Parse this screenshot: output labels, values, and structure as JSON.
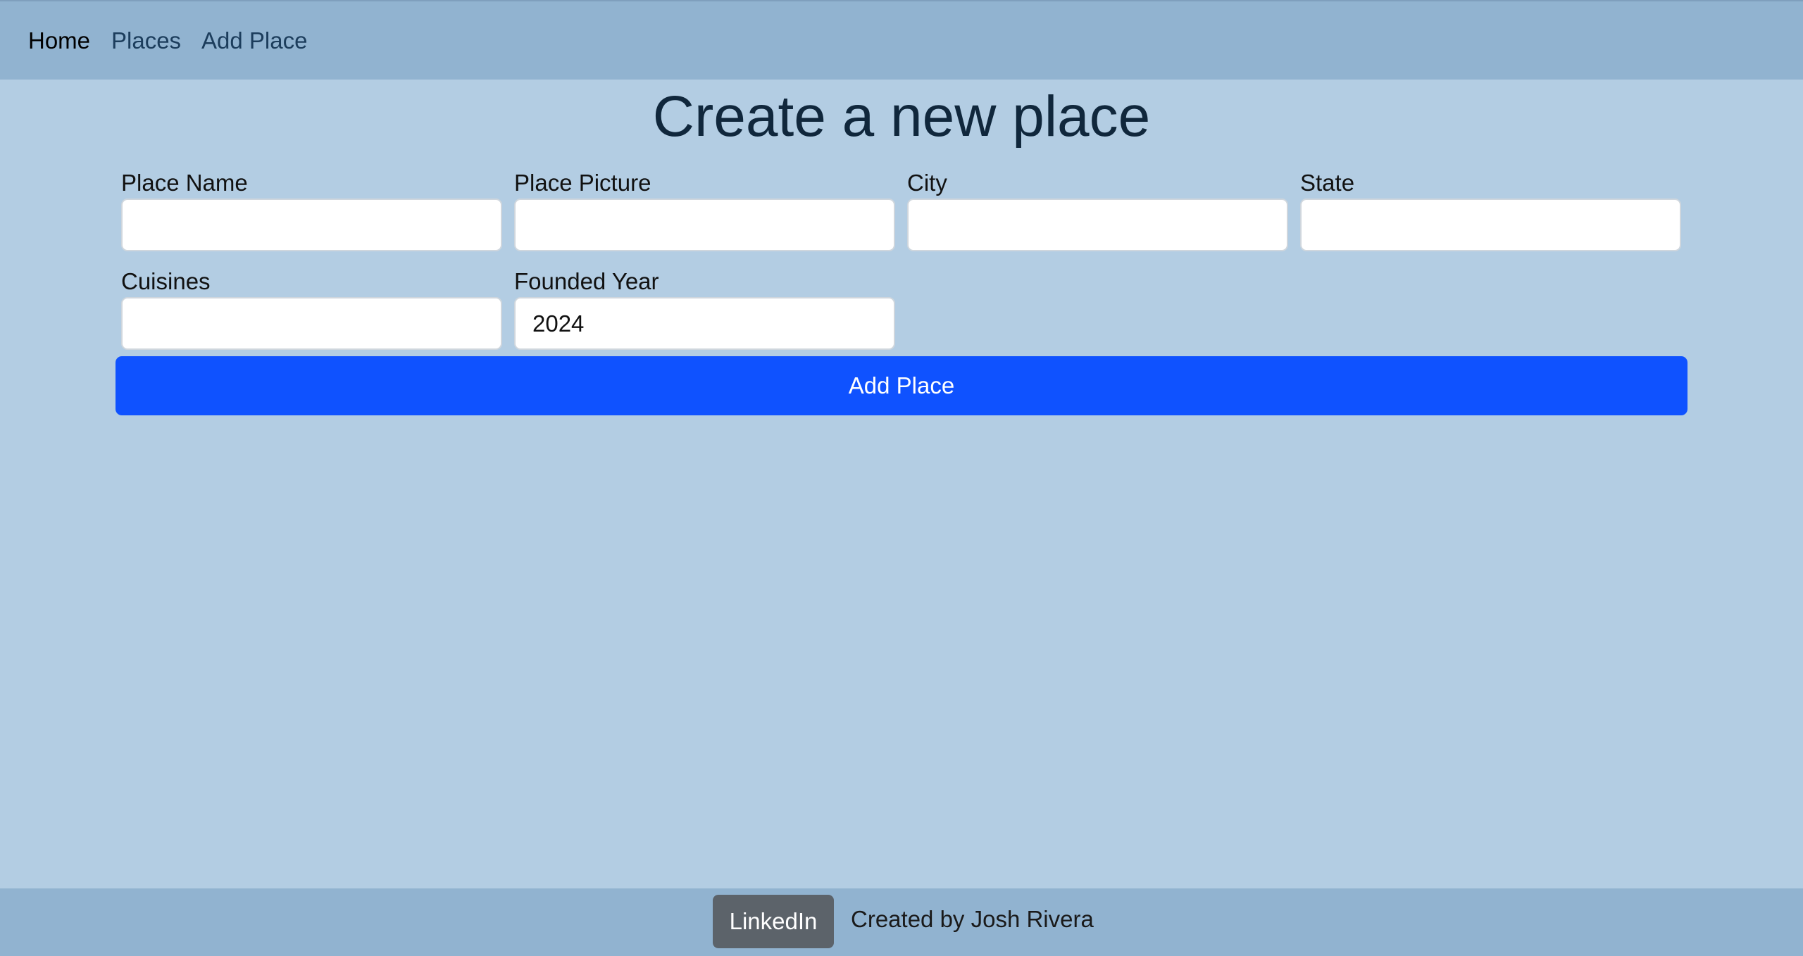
{
  "nav": {
    "items": [
      {
        "label": "Home"
      },
      {
        "label": "Places"
      },
      {
        "label": "Add Place"
      }
    ]
  },
  "page": {
    "title": "Create a new place"
  },
  "form": {
    "fields": [
      {
        "label": "Place Name",
        "value": ""
      },
      {
        "label": "Place Picture",
        "value": ""
      },
      {
        "label": "City",
        "value": ""
      },
      {
        "label": "State",
        "value": ""
      },
      {
        "label": "Cuisines",
        "value": ""
      },
      {
        "label": "Founded Year",
        "value": "2024"
      }
    ],
    "submit_label": "Add Place"
  },
  "footer": {
    "linkedin_label": "LinkedIn",
    "credit": "Created by Josh Rivera"
  },
  "colors": {
    "background": "#b3cde3",
    "navbar": "#91b3d0",
    "primary_button": "#0f52ff",
    "secondary_button": "#5c636a",
    "title_text": "#10273c"
  }
}
